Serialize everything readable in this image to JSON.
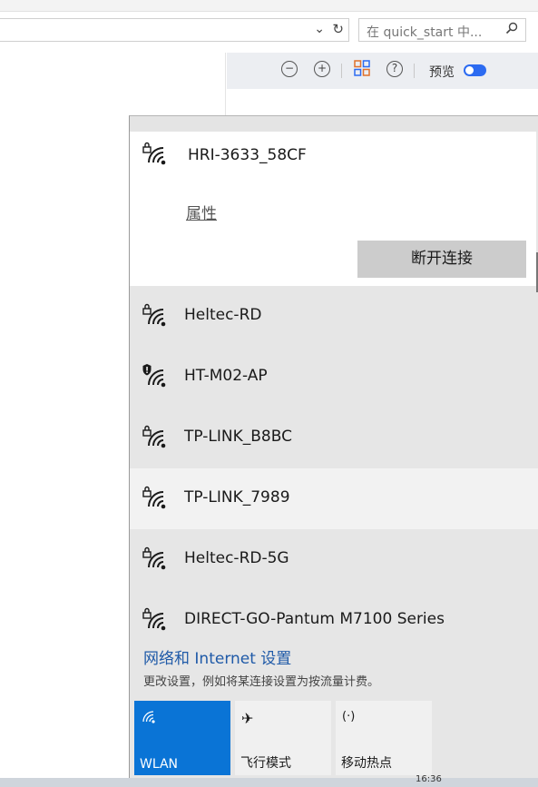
{
  "explorer": {
    "address_dropdown_icon": "chevron-down-icon",
    "address_dropdown_glyph": "⌄",
    "refresh_glyph": "↻",
    "search_placeholder": "在 quick_start 中...",
    "search_glyph": "⌕"
  },
  "viewer_toolbar": {
    "zoom_out_glyph": "−",
    "zoom_in_glyph": "+",
    "help_glyph": "?",
    "preview_label": "预览",
    "preview_toggle_on": true,
    "accent_color": "#2c6bf1"
  },
  "wifi_flyout": {
    "connected_network": {
      "name": "HRI-3633_58CF",
      "properties_label": "属性",
      "disconnect_label": "断开连接"
    },
    "networks": [
      {
        "name": "Heltec-RD",
        "icon": "wifi-lock-icon"
      },
      {
        "name": "HT-M02-AP",
        "icon": "wifi-shield-icon"
      },
      {
        "name": "TP-LINK_B8BC",
        "icon": "wifi-lock-icon"
      },
      {
        "name": "TP-LINK_7989",
        "icon": "wifi-lock-icon",
        "hovered": true
      },
      {
        "name": "Heltec-RD-5G",
        "icon": "wifi-lock-icon"
      },
      {
        "name": "DIRECT-GO-Pantum M7100 Series",
        "icon": "wifi-lock-icon"
      }
    ],
    "settings_link": "网络和 Internet 设置",
    "settings_subtext": "更改设置，例如将某连接设置为按流量计费。",
    "quick_actions": [
      {
        "label": "WLAN",
        "icon": "wifi-icon",
        "active": true,
        "glyph": "((·"
      },
      {
        "label": "飞行模式",
        "icon": "airplane-icon",
        "active": false,
        "glyph": "✈"
      },
      {
        "label": "移动热点",
        "icon": "hotspot-icon",
        "active": false,
        "glyph": "(·)"
      }
    ],
    "tile_active_color": "#0a74d6"
  },
  "taskbar": {
    "clock_partial": "16:36"
  }
}
